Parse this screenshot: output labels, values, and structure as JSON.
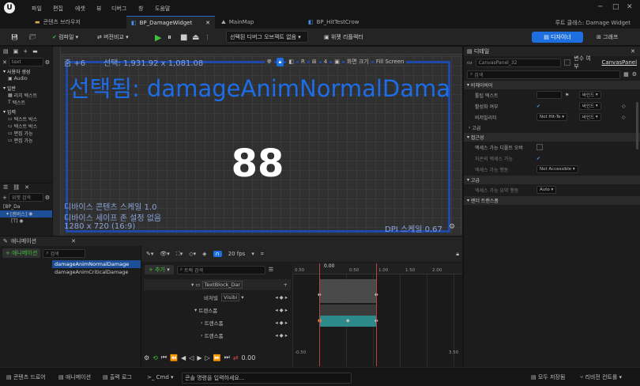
{
  "menu": [
    "파일",
    "편집",
    "에셋",
    "뷰",
    "디버그",
    "창",
    "도움말"
  ],
  "window_title": "루트 클래스: Damage Widget",
  "tabs": [
    {
      "label": "콘텐츠 브라우저"
    },
    {
      "label": "BP_DamageWidget"
    },
    {
      "label": "MainMap"
    },
    {
      "label": "BP_HitTestCrow"
    }
  ],
  "toolbar": {
    "compile": "컴파일",
    "diff": "버전비교",
    "debug_filter": "선택된 디버그 오브젝트 없음",
    "widget_reflector": "위젯 리플렉터",
    "designer": "디자이너",
    "graph": "그래프"
  },
  "palette": {
    "search_value": "text",
    "sections": [
      {
        "title": "사용자 생성",
        "items": [
          "Audio"
        ]
      },
      {
        "title": "일반",
        "items": [
          "리치 텍스트",
          "텍스트"
        ]
      },
      {
        "title": "입력",
        "items": [
          "텍스트 박스",
          "텍스트 박스",
          "편집 가능",
          "편집 가능"
        ]
      }
    ]
  },
  "hierarchy": {
    "search_placeholder": "위젯 검색",
    "items": [
      "[BP_Da",
      "[캔버스]",
      "[T]"
    ]
  },
  "viewport": {
    "zoom": "줌 +6",
    "selection": "선택: 1,931.92 x 1,081.08",
    "title": "선택됨: damageAnimNormalDama",
    "number": "88",
    "scale": "디바이스 콘텐츠 스케일 1.0",
    "safe_zone": "디바이스 세이프 존 설정 없음",
    "resolution": "1280 x 720 (16:9)",
    "dpi": "DPI 스케일 0.67",
    "screen_size": "화면 크기",
    "fill_mode": "Fill Screen",
    "count": "4",
    "resolution_btn": "R"
  },
  "details": {
    "title": "디테일",
    "widget_name": "CanvasPanel_32",
    "is_variable": "변수 여부",
    "canvas_link": "CanvasPanel",
    "search_placeholder": "검색",
    "sections": [
      {
        "title": "비헤이비어",
        "rows": [
          {
            "label": "툴팁 텍스트",
            "value": "",
            "bind": "바인드"
          },
          {
            "label": "활성화 여부",
            "value": "✔",
            "bind": "바인드"
          },
          {
            "label": "비저빌리티",
            "value": "Not Hit-Te",
            "bind": "바인드"
          }
        ]
      },
      {
        "title": "고급",
        "rows": []
      },
      {
        "title": "접근성",
        "rows": [
          {
            "label": "액세스 가능 디폴트 오버",
            "value": "",
            "bind": ""
          },
          {
            "label": "자손의 액세스 가능",
            "value": "",
            "bind": ""
          },
          {
            "label": "액세스 가능 행동",
            "value": "Not Accessible",
            "bind": ""
          }
        ]
      },
      {
        "title": "고급",
        "rows": [
          {
            "label": "액세스 가능 요약 행동",
            "value": "Auto",
            "bind": ""
          }
        ]
      },
      {
        "title": "렌더 트랜스폼",
        "rows": []
      }
    ]
  },
  "animations": {
    "tab": "애니메이션",
    "add_button": "+ 애니메이션",
    "search_placeholder": "검색",
    "list": [
      "damageAnimNormalDamage",
      "damageAnimCriticalDamage"
    ],
    "add_track": "+ 추가",
    "track_search": "트랙 검색",
    "fps": "20 fps",
    "tracks": [
      {
        "label": "TextBlock_Dar"
      },
      {
        "label": "비저빌",
        "value": "Visibi"
      },
      {
        "label": "트랜스폼"
      },
      {
        "label": "트랜스폼"
      },
      {
        "label": "트랜스폼"
      }
    ],
    "ticks": [
      "0.50",
      "0.00",
      "0.50",
      "1.00",
      "1.50",
      "2.00",
      "2.50",
      "3.00",
      "3.50"
    ],
    "time_top": "0.00",
    "time_bottom": "0.00",
    "bottom_left": "-0.50",
    "bottom_right": "3.50"
  },
  "statusbar": {
    "content_drawer": "콘텐츠 드로어",
    "animation": "애니메이션",
    "output_log": "출력 로그",
    "cmd": "Cmd",
    "console_placeholder": "콘솔 명령을 입력하세요...",
    "save": "모두 저장됨",
    "source_control": "리비전 컨트롤"
  }
}
